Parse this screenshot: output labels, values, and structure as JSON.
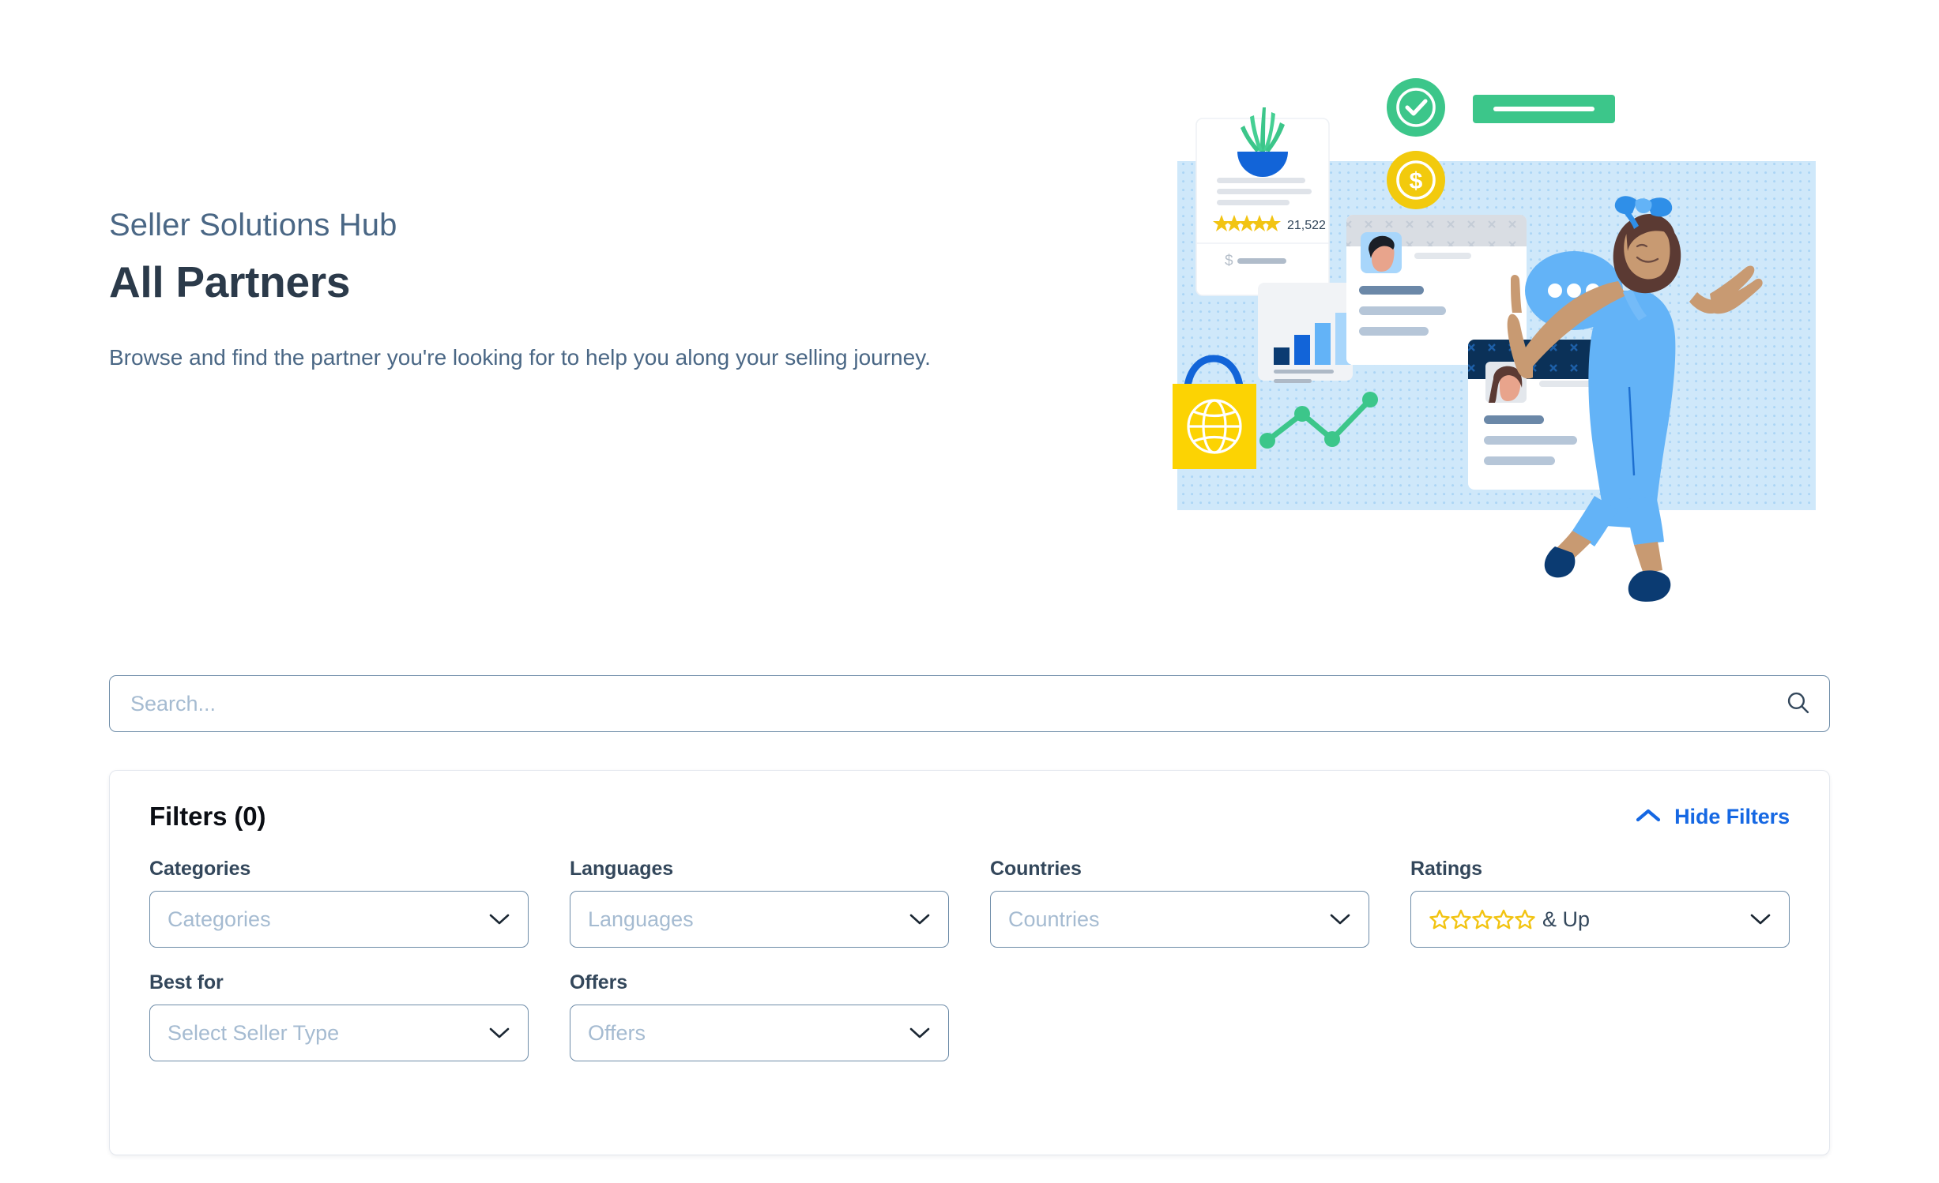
{
  "hero": {
    "eyebrow": "Seller Solutions Hub",
    "title": "All Partners",
    "description": "Browse and find the partner you're looking for to help you along your selling journey."
  },
  "illustration": {
    "product_card": {
      "rating_stars": 5,
      "review_count": "21,522",
      "price_symbol": "$"
    },
    "badges": [
      {
        "name": "verified-check-badge",
        "color": "#3cc68a"
      },
      {
        "name": "dollar-coin-badge",
        "color": "#f2ca0d"
      }
    ],
    "panel_color": "#cfe8fa",
    "accent_colors": {
      "green": "#3cc68a",
      "yellow": "#fcd303",
      "blue": "#1264d8",
      "light_blue": "#63b3f7",
      "navy": "#0b3b72",
      "navy_dark": "#0c3b6e"
    }
  },
  "search": {
    "placeholder": "Search...",
    "value": "",
    "icon": "search-icon"
  },
  "filters": {
    "title": "Filters (0)",
    "count": 0,
    "toggle_label": "Hide Filters",
    "toggle_icon": "chevron-up-icon",
    "toggle_color": "#1668e3",
    "rows": [
      [
        {
          "key": "categories",
          "label": "Categories",
          "placeholder": "Categories",
          "value": "",
          "type": "select"
        },
        {
          "key": "languages",
          "label": "Languages",
          "placeholder": "Languages",
          "value": "",
          "type": "select"
        },
        {
          "key": "countries",
          "label": "Countries",
          "placeholder": "Countries",
          "value": "",
          "type": "select"
        },
        {
          "key": "ratings",
          "label": "Ratings",
          "placeholder": "& Up",
          "value": "& Up",
          "type": "rating",
          "stars": 5,
          "star_color": "#f2c413"
        }
      ],
      [
        {
          "key": "best_for",
          "label": "Best for",
          "placeholder": "Select Seller Type",
          "value": "",
          "type": "select"
        },
        {
          "key": "offers",
          "label": "Offers",
          "placeholder": "Offers",
          "value": "",
          "type": "select"
        }
      ]
    ]
  }
}
